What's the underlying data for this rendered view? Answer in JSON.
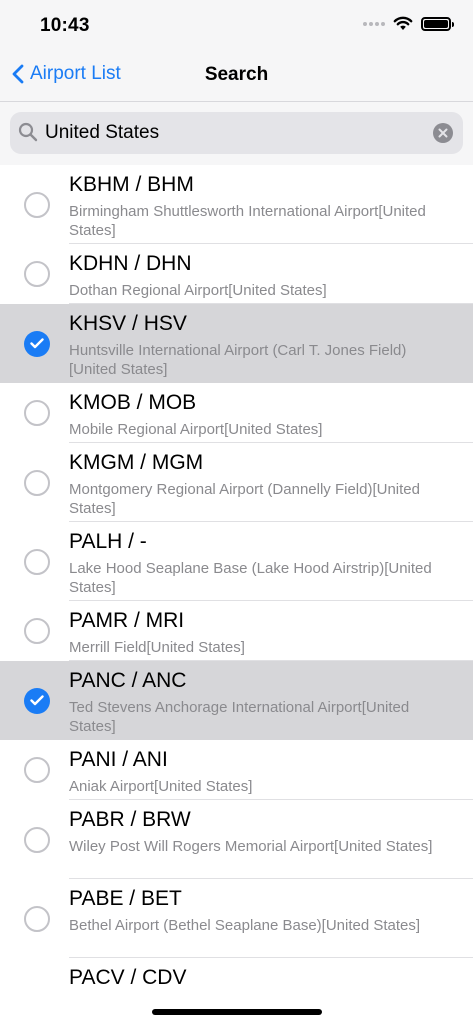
{
  "status": {
    "time": "10:43"
  },
  "nav": {
    "back_label": "Airport List",
    "title": "Search"
  },
  "search": {
    "value": "United States"
  },
  "colors": {
    "accent": "#1a7cf5",
    "selected_row": "#d6d6d9",
    "secondary_text": "#8a8a8e"
  },
  "airports": [
    {
      "code": "KBHM / BHM",
      "description": "Birmingham Shuttlesworth International Airport[United States]",
      "selected": false
    },
    {
      "code": "KDHN / DHN",
      "description": "Dothan Regional Airport[United States]",
      "selected": false
    },
    {
      "code": "KHSV / HSV",
      "description": "Huntsville International Airport (Carl T. Jones Field)[United States]",
      "selected": true
    },
    {
      "code": "KMOB / MOB",
      "description": "Mobile Regional Airport[United States]",
      "selected": false
    },
    {
      "code": "KMGM / MGM",
      "description": "Montgomery Regional Airport (Dannelly Field)[United States]",
      "selected": false
    },
    {
      "code": "PALH / -",
      "description": "Lake Hood Seaplane Base (Lake Hood Airstrip)[United States]",
      "selected": false
    },
    {
      "code": "PAMR / MRI",
      "description": "Merrill Field[United States]",
      "selected": false
    },
    {
      "code": "PANC / ANC",
      "description": "Ted Stevens Anchorage International Airport[United States]",
      "selected": true
    },
    {
      "code": "PANI / ANI",
      "description": "Aniak Airport[United States]",
      "selected": false
    },
    {
      "code": "PABR / BRW",
      "description": "Wiley Post Will Rogers Memorial Airport[United States]",
      "selected": false
    },
    {
      "code": "PABE / BET",
      "description": "Bethel Airport (Bethel Seaplane Base)[United States]",
      "selected": false
    },
    {
      "code": "PACV / CDV",
      "description": "",
      "selected": false
    }
  ]
}
